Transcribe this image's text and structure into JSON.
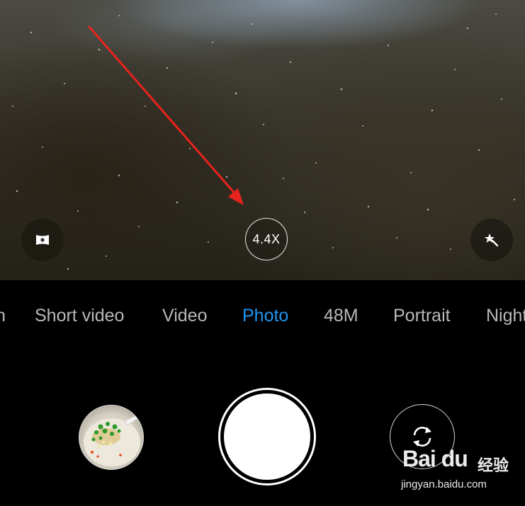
{
  "camera": {
    "zoom_label": "4.4X",
    "modes": [
      {
        "label": "Short video",
        "active": false
      },
      {
        "label": "Video",
        "active": false
      },
      {
        "label": "Photo",
        "active": true
      },
      {
        "label": "48M",
        "active": false
      },
      {
        "label": "Portrait",
        "active": false
      },
      {
        "label": "Night",
        "active": false
      }
    ],
    "active_color": "#1f95f0",
    "inactive_color": "#b9b9b9",
    "icons": {
      "panorama": "panorama-icon",
      "effects": "magic-wand-icon",
      "switch_camera": "switch-camera-icon"
    }
  },
  "annotation": {
    "arrow_color": "#e8231d"
  },
  "watermark": {
    "logo": "Bai du",
    "product": "经验",
    "url": "jingyan.baidu.com"
  }
}
